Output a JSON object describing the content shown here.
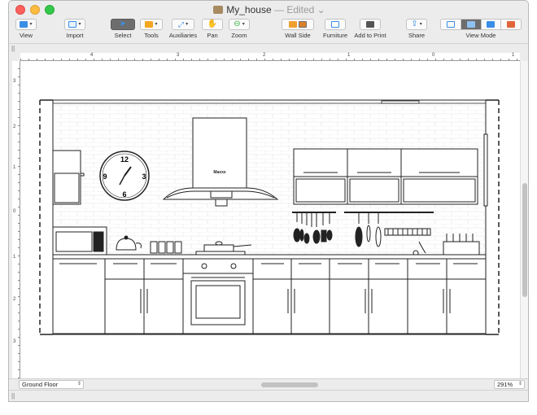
{
  "window": {
    "title": "My_house",
    "separator": "—",
    "status": "Edited"
  },
  "toolbar": {
    "view": "View",
    "import": "Import",
    "select": "Select",
    "tools": "Tools",
    "auxiliaries": "Auxiliaries",
    "pan": "Pan",
    "zoom": "Zoom",
    "wall_side": "Wall Side",
    "furniture": "Furniture",
    "add_to_print": "Add to Print",
    "share": "Share",
    "view_mode": "View Mode"
  },
  "ruler": {
    "horizontal": [
      "4",
      "3",
      "2",
      "1",
      "0",
      "1"
    ],
    "vertical": [
      "3",
      "2",
      "1",
      "0",
      "1",
      "2",
      "3"
    ]
  },
  "drawing": {
    "hood_brand": "Maxxx",
    "clock_numbers": [
      "12",
      "3",
      "6",
      "9"
    ]
  },
  "bottombar": {
    "floor": "Ground Floor",
    "zoom": "291%"
  },
  "colors": {
    "select_active": "#6d6d6d",
    "accent_blue": "#3a8ee6",
    "tools_orange": "#f5a623",
    "wall_side_orange": "#f0a030",
    "zoom_green": "#3bb34a"
  }
}
